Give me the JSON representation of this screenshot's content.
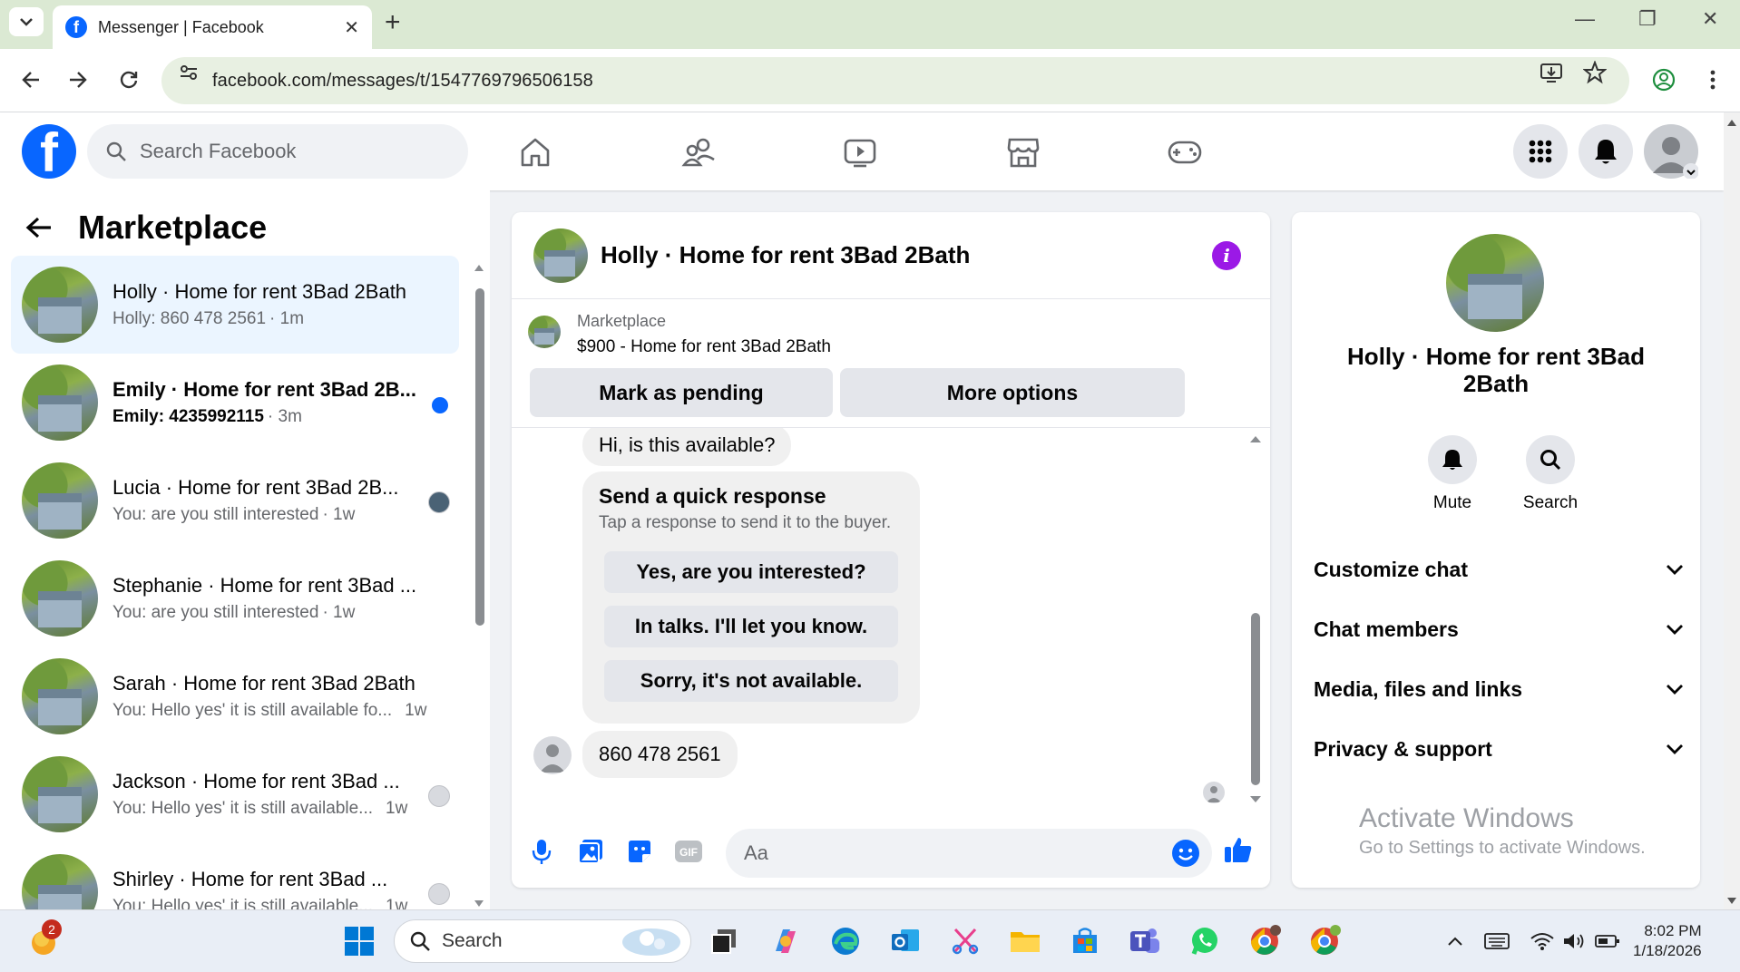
{
  "browser": {
    "tab_title": "Messenger | Facebook",
    "url": "facebook.com/messages/t/1547769796506158"
  },
  "header": {
    "search_placeholder": "Search Facebook"
  },
  "left": {
    "title": "Marketplace",
    "chats": [
      {
        "name": "Holly · Home for rent 3Bad 2Bath",
        "message": "Holly: 860 478 2561",
        "time": "· 1m",
        "active": true,
        "unread": false,
        "indicator": "none"
      },
      {
        "name": "Emily · Home for rent 3Bad 2B...",
        "message": "Emily: 4235992115",
        "time": "· 3m",
        "active": false,
        "unread": true,
        "indicator": "dot"
      },
      {
        "name": "Lucia · Home for rent 3Bad 2B...",
        "message": "You: are you still interested",
        "time": "· 1w",
        "active": false,
        "unread": false,
        "indicator": "seen"
      },
      {
        "name": "Stephanie · Home for rent 3Bad ...",
        "message": "You: are you still interested",
        "time": "· 1w",
        "active": false,
        "unread": false,
        "indicator": "none"
      },
      {
        "name": "Sarah · Home for rent 3Bad 2Bath",
        "message": "You: Hello yes' it is still available fo...",
        "time": "1w",
        "active": false,
        "unread": false,
        "indicator": "none"
      },
      {
        "name": "Jackson · Home for rent 3Bad ...",
        "message": "You: Hello yes' it is still available...",
        "time": "1w",
        "active": false,
        "unread": false,
        "indicator": "seen"
      },
      {
        "name": "Shirley · Home for rent 3Bad ...",
        "message": "You: Hello yes' it is still available...",
        "time": "1w",
        "active": false,
        "unread": false,
        "indicator": "seen"
      }
    ]
  },
  "convo": {
    "title": "Holly · Home for rent 3Bad 2Bath",
    "marketplace_label": "Marketplace",
    "item": "$900 - Home for rent 3Bad 2Bath",
    "mark_pending": "Mark as pending",
    "more_options": "More options",
    "msg_available": "Hi, is this available?",
    "quick_title": "Send a quick response",
    "quick_sub": "Tap a response to send it to the buyer.",
    "quick_options": [
      "Yes, are you interested?",
      "In talks. I'll let you know.",
      "Sorry, it's not available."
    ],
    "msg_phone": "860 478 2561",
    "composer_placeholder": "Aa"
  },
  "details": {
    "name": "Holly · Home for rent 3Bad 2Bath",
    "mute": "Mute",
    "search": "Search",
    "sections": [
      "Customize chat",
      "Chat members",
      "Media, files and links",
      "Privacy & support"
    ]
  },
  "watermark": {
    "title": "Activate Windows",
    "sub": "Go to Settings to activate Windows."
  },
  "taskbar": {
    "search_placeholder": "Search",
    "time": "8:02 PM",
    "date": "1/18/2026",
    "notification_count": "2"
  },
  "colors": {
    "fb_blue": "#0866ff",
    "info_purple": "#9b19e6",
    "active_chat_bg": "#ebf5ff"
  }
}
